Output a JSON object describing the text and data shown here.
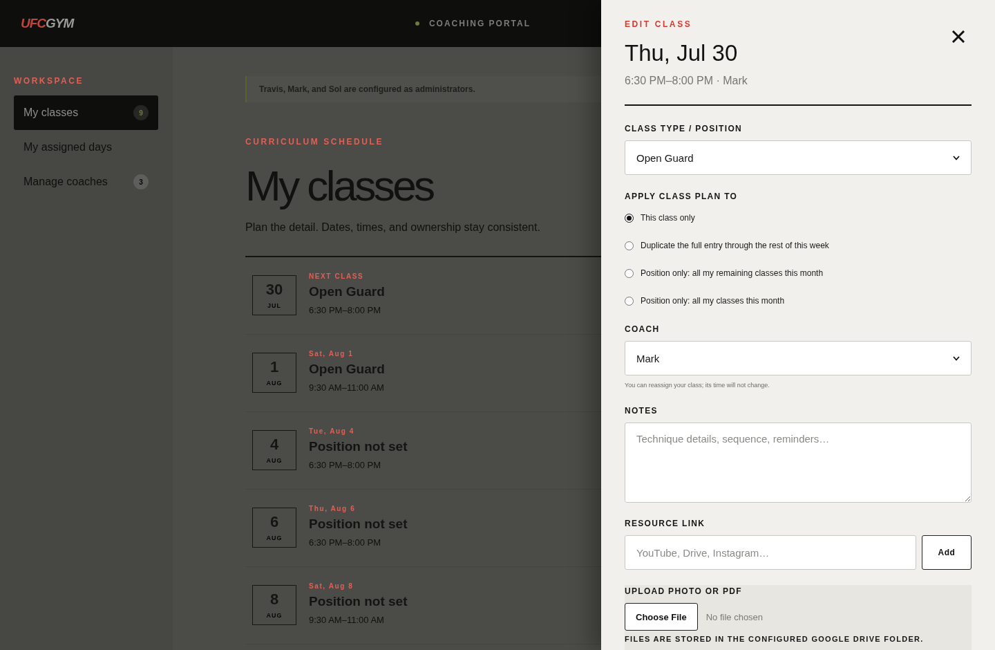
{
  "header": {
    "logo_accent": "UFC",
    "logo_text": "GYM",
    "portal_label": "COACHING PORTAL"
  },
  "sidebar": {
    "section_label": "WORKSPACE",
    "items": [
      {
        "label": "My classes",
        "count": "9",
        "selected": true
      },
      {
        "label": "My assigned days",
        "selected": false
      },
      {
        "label": "Manage coaches",
        "count": "3",
        "selected": false
      }
    ]
  },
  "main": {
    "notice": "Travis, Mark, and Sol are configured as administrators.",
    "eyebrow": "CURRICULUM SCHEDULE",
    "title": "My classes",
    "subtitle": "Plan the detail. Dates, times, and ownership stay consistent.",
    "classes": [
      {
        "day": "30",
        "month": "JUL",
        "label": "NEXT CLASS",
        "title": "Open Guard",
        "time": "6:30 PM–8:00 PM"
      },
      {
        "day": "1",
        "month": "AUG",
        "label": "Sat, Aug 1",
        "title": "Open Guard",
        "time": "9:30 AM–11:00 AM"
      },
      {
        "day": "4",
        "month": "AUG",
        "label": "Tue, Aug 4",
        "title": "Position not set",
        "time": "6:30 PM–8:00 PM"
      },
      {
        "day": "6",
        "month": "AUG",
        "label": "Thu, Aug 6",
        "title": "Position not set",
        "time": "6:30 PM–8:00 PM"
      },
      {
        "day": "8",
        "month": "AUG",
        "label": "Sat, Aug 8",
        "title": "Position not set",
        "time": "9:30 AM–11:00 AM"
      }
    ]
  },
  "drawer": {
    "eyebrow": "EDIT CLASS",
    "title": "Thu, Jul 30",
    "subtitle": "6:30 PM–8:00 PM · Mark",
    "class_type": {
      "label": "CLASS TYPE / POSITION",
      "value": "Open Guard"
    },
    "apply_to": {
      "label": "APPLY CLASS PLAN TO",
      "options": [
        {
          "label": "This class only",
          "selected": true
        },
        {
          "label": "Duplicate the full entry through the rest of this week",
          "selected": false
        },
        {
          "label": "Position only: all my remaining classes this month",
          "selected": false
        },
        {
          "label": "Position only: all my classes this month",
          "selected": false
        }
      ]
    },
    "coach": {
      "label": "COACH",
      "value": "Mark",
      "help": "You can reassign your class; its time will not change."
    },
    "notes": {
      "label": "NOTES",
      "placeholder": "Technique details, sequence, reminders…"
    },
    "resource_link": {
      "label": "RESOURCE LINK",
      "placeholder": "YouTube, Drive, Instagram…",
      "button": "Add"
    },
    "upload": {
      "label": "UPLOAD PHOTO OR PDF",
      "button": "Choose File",
      "status": "No file chosen",
      "note": "FILES ARE STORED IN THE CONFIGURED GOOGLE DRIVE FOLDER."
    }
  }
}
